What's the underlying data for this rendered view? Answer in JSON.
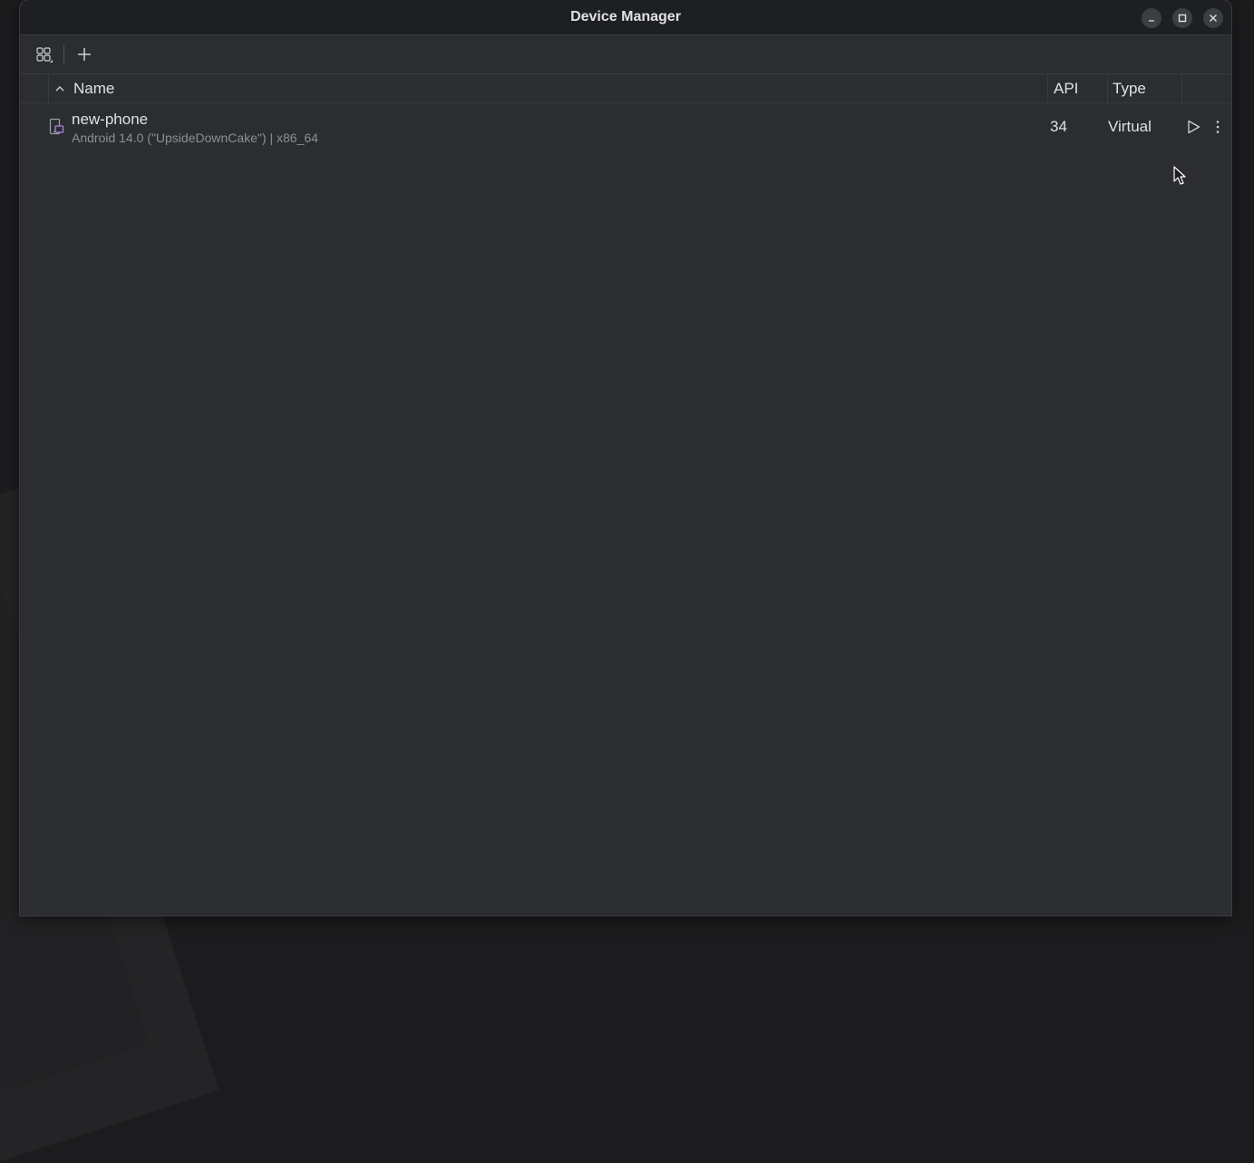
{
  "window": {
    "title": "Device Manager"
  },
  "toolbar": {
    "device_view_icon": "grid-view-icon",
    "add_icon": "plus-icon"
  },
  "table": {
    "sort_indicator": "chevron-up-icon",
    "columns": {
      "name": "Name",
      "api": "API",
      "type": "Type"
    },
    "rows": [
      {
        "name": "new-phone",
        "details": "Android 14.0 (\"UpsideDownCake\") | x86_64",
        "api": "34",
        "type": "Virtual",
        "icon": "virtual-device-icon",
        "icon_color": "#b084e0"
      }
    ]
  },
  "colors": {
    "background": "#2b2d30",
    "titlebar": "#1e1f22",
    "text": "#dfe1e5",
    "secondary_text": "#8c8f94"
  }
}
